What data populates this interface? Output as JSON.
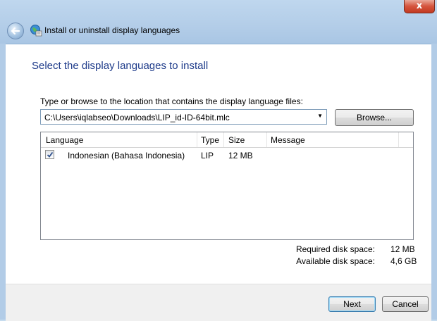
{
  "window": {
    "title": "Install or uninstall display languages",
    "close_label": "x"
  },
  "page": {
    "heading": "Select the display languages to install",
    "prompt": "Type or browse to the location that contains the display language files:",
    "path_value": "C:\\Users\\iqlabseo\\Downloads\\LIP_id-ID-64bit.mlc",
    "browse_label": "Browse..."
  },
  "list": {
    "columns": [
      "Language",
      "Type",
      "Size",
      "Message"
    ],
    "rows": [
      {
        "checked": true,
        "language": "Indonesian (Bahasa Indonesia)",
        "type": "LIP",
        "size": "12 MB",
        "message": ""
      }
    ]
  },
  "disk": {
    "required_label": "Required disk space:",
    "required_value": "12 MB",
    "available_label": "Available disk space:",
    "available_value": "4,6 GB"
  },
  "buttons": {
    "next": "Next",
    "cancel": "Cancel"
  },
  "colors": {
    "heading": "#1e3b8a",
    "frame": "#b3cde8",
    "close": "#c23a22"
  }
}
